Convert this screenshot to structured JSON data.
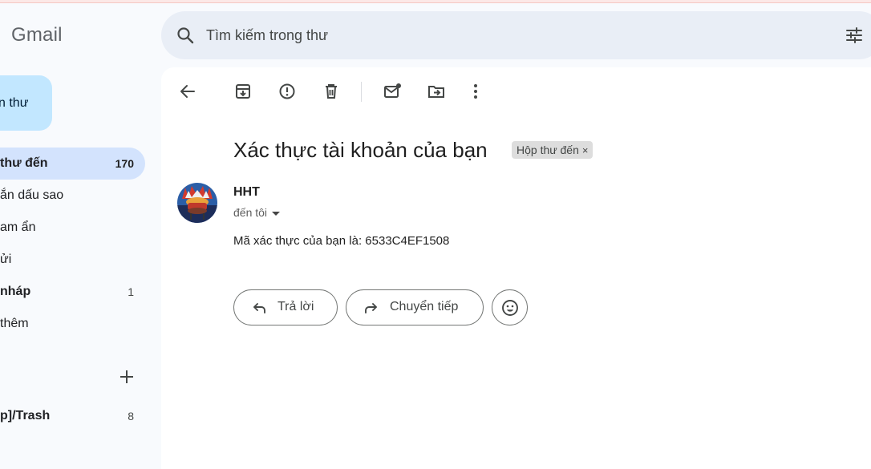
{
  "app": {
    "brand": "Gmail"
  },
  "search": {
    "placeholder": "Tìm kiếm trong thư"
  },
  "sidebar": {
    "compose_label": "n thư",
    "items": [
      {
        "label": "thư đến",
        "count": "170"
      },
      {
        "label": "ắn dấu sao",
        "count": ""
      },
      {
        "label": "am ẩn",
        "count": ""
      },
      {
        "label": "ửi",
        "count": ""
      },
      {
        "label": "nháp",
        "count": "1"
      },
      {
        "label": "thêm",
        "count": ""
      },
      {
        "label": "p]/Trash",
        "count": "8"
      }
    ]
  },
  "email": {
    "subject": "Xác thực tài khoản của bạn",
    "label_chip": "Hộp thư đến",
    "chip_close": "×",
    "sender": "HHT",
    "recipient": "đến tôi",
    "body": "Mã xác thực của bạn là: 6533C4EF1508"
  },
  "actions": {
    "reply": "Trả lời",
    "forward": "Chuyển tiếp"
  },
  "colors": {
    "active_nav": "#d3e3fd",
    "compose": "#c2e7ff",
    "search_bg": "#e9eef6",
    "page_bg": "#f8fafd"
  }
}
